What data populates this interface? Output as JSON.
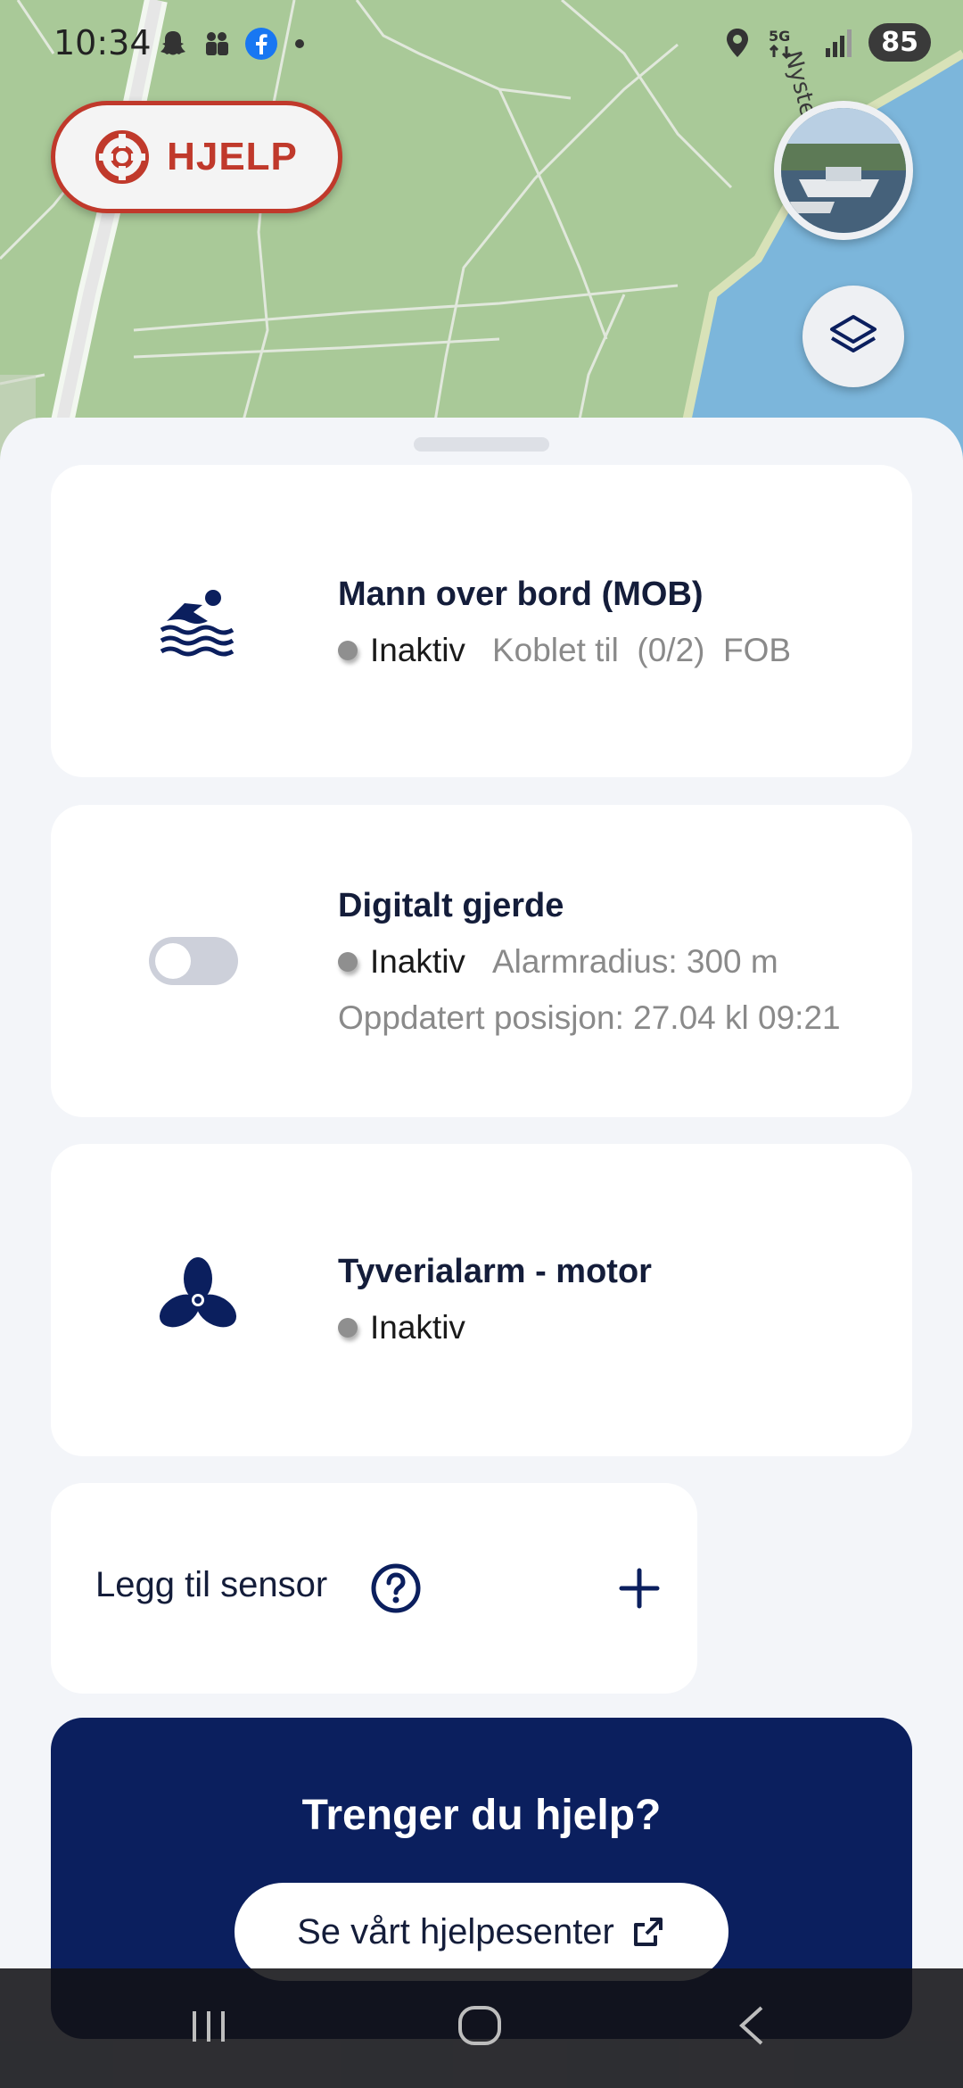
{
  "status_bar": {
    "time": "10:34",
    "battery": "85",
    "network": "5G"
  },
  "map": {
    "road_label": "Nysten"
  },
  "header": {
    "help_label": "HJELP"
  },
  "cards": [
    {
      "title": "Mann over bord (MOB)",
      "status": "Inaktiv",
      "detail": "Koblet til  (0/2)  FOB",
      "icon": "swimmer-icon"
    },
    {
      "title": "Digitalt gjerde",
      "status": "Inaktiv",
      "detail": "Alarmradius: 300 m",
      "detail2": "Oppdatert posisjon:  27.04 kl 09:21",
      "icon": "toggle-switch",
      "toggle_on": false
    },
    {
      "title": "Tyverialarm - motor",
      "status": "Inaktiv",
      "icon": "propeller-icon"
    }
  ],
  "add_sensor": {
    "label": "Legg til sensor"
  },
  "help_banner": {
    "title": "Trenger du hjelp?",
    "cta_label": "Se vårt hjelpesenter"
  },
  "colors": {
    "brand_navy": "#0b1f5e",
    "alert_red": "#c0392b",
    "inactive_dot": "#8f8f8f"
  }
}
